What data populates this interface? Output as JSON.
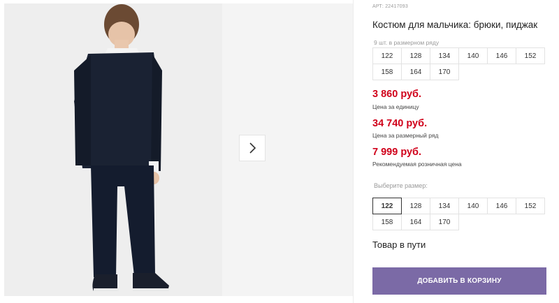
{
  "gallery": {
    "next_icon": "chevron-right-icon",
    "photo_description_icon": "product-photo"
  },
  "product": {
    "article_label": "АРТ:",
    "article_number": "22417093",
    "title": "Костюм для мальчика: брюки, пиджак",
    "range_caption": "9 шт. в размерном ряду",
    "range_sizes": [
      "122",
      "128",
      "134",
      "140",
      "146",
      "152",
      "158",
      "164",
      "170"
    ],
    "prices": {
      "unit_price": "3 860 руб.",
      "unit_label": "Цена за единицу",
      "range_price": "34 740 руб.",
      "range_label": "Цена за размерный ряд",
      "retail_price": "7 999 руб.",
      "retail_label": "Рекомендуемая розничная цена"
    },
    "choose_size_label": "Выберите размер:",
    "size_options": [
      "122",
      "128",
      "134",
      "140",
      "146",
      "152",
      "158",
      "164",
      "170"
    ],
    "selected_size": "122",
    "status": "Товар в пути",
    "add_to_cart": "ДОБАВИТЬ В КОРЗИНУ"
  },
  "colors": {
    "price": "#d0021b",
    "cart_button": "#7b6aa6",
    "photo_background": "#eeeeee"
  }
}
